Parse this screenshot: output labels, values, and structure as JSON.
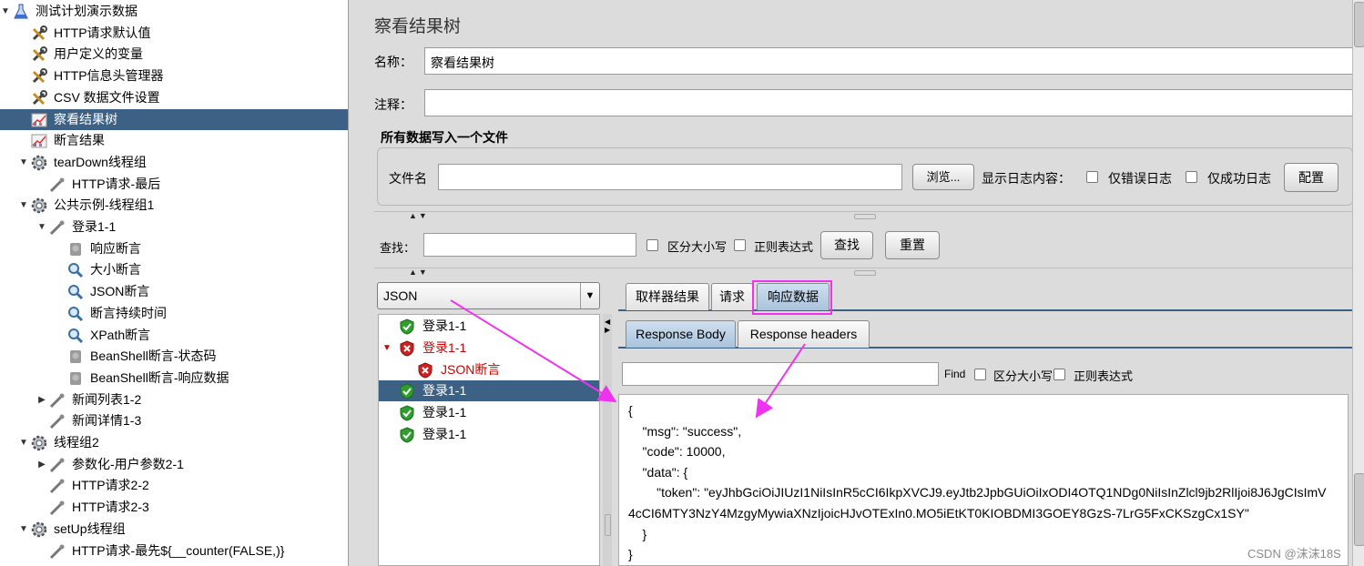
{
  "tree": {
    "items": [
      {
        "label": "测试计划演示数据",
        "icon": "flask-icon",
        "toggle": "▼",
        "level": 0
      },
      {
        "label": "HTTP请求默认值",
        "icon": "wrench-icon",
        "toggle": "",
        "level": 1
      },
      {
        "label": "用户定义的变量",
        "icon": "wrench-icon",
        "toggle": "",
        "level": 1
      },
      {
        "label": "HTTP信息头管理器",
        "icon": "wrench-icon",
        "toggle": "",
        "level": 1
      },
      {
        "label": "CSV 数据文件设置",
        "icon": "wrench-icon",
        "toggle": "",
        "level": 1
      },
      {
        "label": "察看结果树",
        "icon": "chart-icon",
        "toggle": "",
        "level": 1,
        "selected": true
      },
      {
        "label": "断言结果",
        "icon": "chart-icon",
        "toggle": "",
        "level": 1
      },
      {
        "label": "tearDown线程组",
        "icon": "gear-icon",
        "toggle": "▼",
        "level": 1
      },
      {
        "label": "HTTP请求-最后",
        "icon": "pipette-icon",
        "toggle": "",
        "level": 2
      },
      {
        "label": "公共示例-线程组1",
        "icon": "gear-icon",
        "toggle": "▼",
        "level": 1
      },
      {
        "label": "登录1-1",
        "icon": "pipette-icon",
        "toggle": "▼",
        "level": 2
      },
      {
        "label": "响应断言",
        "icon": "stamp-icon",
        "toggle": "",
        "level": 3
      },
      {
        "label": "大小断言",
        "icon": "magnifier-icon",
        "toggle": "",
        "level": 3
      },
      {
        "label": "JSON断言",
        "icon": "magnifier-icon",
        "toggle": "",
        "level": 3
      },
      {
        "label": "断言持续时间",
        "icon": "magnifier-icon",
        "toggle": "",
        "level": 3
      },
      {
        "label": "XPath断言",
        "icon": "magnifier-icon",
        "toggle": "",
        "level": 3
      },
      {
        "label": "BeanShell断言-状态码",
        "icon": "stamp-icon",
        "toggle": "",
        "level": 3
      },
      {
        "label": "BeanShell断言-响应数据",
        "icon": "stamp-icon",
        "toggle": "",
        "level": 3
      },
      {
        "label": "新闻列表1-2",
        "icon": "pipette-icon",
        "toggle": "▶",
        "level": 2
      },
      {
        "label": "新闻详情1-3",
        "icon": "pipette-icon",
        "toggle": "",
        "level": 2
      },
      {
        "label": "线程组2",
        "icon": "gear-icon",
        "toggle": "▼",
        "level": 1
      },
      {
        "label": "参数化-用户参数2-1",
        "icon": "pipette-icon",
        "toggle": "▶",
        "level": 2
      },
      {
        "label": "HTTP请求2-2",
        "icon": "pipette-icon",
        "toggle": "",
        "level": 2
      },
      {
        "label": "HTTP请求2-3",
        "icon": "pipette-icon",
        "toggle": "",
        "level": 2
      },
      {
        "label": "setUp线程组",
        "icon": "gear-icon",
        "toggle": "▼",
        "level": 1
      },
      {
        "label": "HTTP请求-最先${__counter(FALSE,)}",
        "icon": "pipette-icon",
        "toggle": "",
        "level": 2
      }
    ]
  },
  "panel": {
    "title": "察看结果树",
    "name_label": "名称：",
    "name_value": "察看结果树",
    "comment_label": "注释：",
    "comment_value": "",
    "file_section_title": "所有数据写入一个文件",
    "filename_label": "文件名",
    "filename_value": "",
    "browse_button": "浏览...",
    "log_content_label": "显示日志内容：",
    "errors_only_label": "仅错误日志",
    "success_only_label": "仅成功日志",
    "configure_button": "配置"
  },
  "search": {
    "label": "查找：",
    "value": "",
    "case_sensitive_label": "区分大小写",
    "regex_label": "正则表达式",
    "find_button": "查找",
    "reset_button": "重置"
  },
  "renderer": {
    "selected": "JSON",
    "arrow": "▼"
  },
  "results": {
    "items": [
      {
        "label": "登录1-1",
        "status": "success",
        "level": 0,
        "toggle": ""
      },
      {
        "label": "登录1-1",
        "status": "error",
        "level": 0,
        "toggle": "▼"
      },
      {
        "label": "JSON断言",
        "status": "error",
        "level": 1,
        "toggle": ""
      },
      {
        "label": "登录1-1",
        "status": "success",
        "level": 0,
        "toggle": "",
        "selected": true
      },
      {
        "label": "登录1-1",
        "status": "success",
        "level": 0,
        "toggle": ""
      },
      {
        "label": "登录1-1",
        "status": "success",
        "level": 0,
        "toggle": ""
      }
    ]
  },
  "tabs": {
    "sampler_result": "取样器结果",
    "request": "请求",
    "response_data": "响应数据",
    "response_body": "Response Body",
    "response_headers": "Response headers"
  },
  "response_find": {
    "value": "",
    "find_label": "Find",
    "case_sensitive_label": "区分大小写",
    "regex_label": "正则表达式"
  },
  "response_body": {
    "lines": [
      "{",
      "    \"msg\": \"success\",",
      "    \"code\": 10000,",
      "    \"data\": {",
      "        \"token\": \"eyJhbGciOiJIUzI1NiIsInR5cCI6IkpXVCJ9.eyJtb2JpbGUiOiIxODI4OTQ1NDg0NiIsInZlcl9jb2RlIjoi8J6JgCIsImV",
      "4cCI6MTY3NzY4MzgyMywiaXNzIjoicHJvOTExIn0.MO5iEtKT0KIOBDMI3GOEY8GzS-7LrG5FxCKSzgCx1SY\"",
      "    }",
      "}"
    ]
  },
  "watermark": "CSDN @沫沫18S",
  "colors": {
    "selection": "#3d6185",
    "annotation": "#ee33ee",
    "error_text": "#cc0000",
    "panel_bg": "#dcdcdc"
  }
}
